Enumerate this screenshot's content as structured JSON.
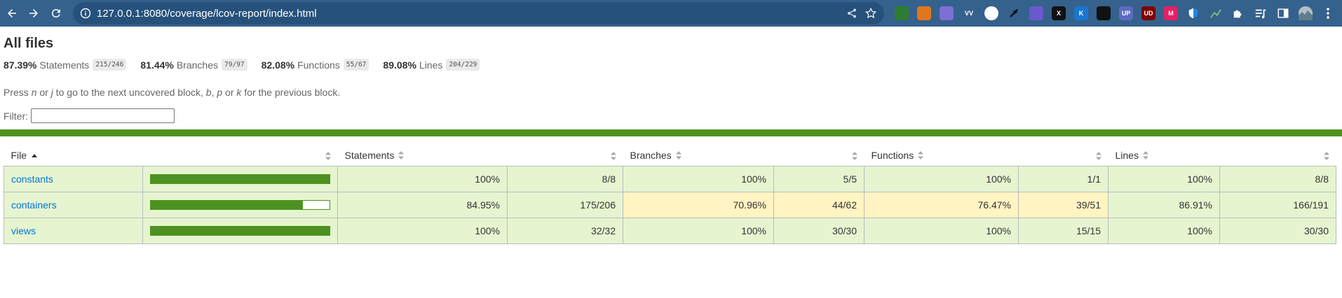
{
  "browser": {
    "url": "127.0.0.1:8080/coverage/lcov-report/index.html"
  },
  "extensions": [
    {
      "name": "ext-turtle-icon",
      "color": "#2e7d32",
      "text": ""
    },
    {
      "name": "ext-fox-icon",
      "color": "#e2761b",
      "text": ""
    },
    {
      "name": "ext-cloud-icon",
      "color": "#7c6fd6",
      "text": ""
    },
    {
      "name": "ext-wv-icon",
      "color": "#35618d",
      "text": "VV"
    },
    {
      "name": "ext-delta-icon",
      "color": "#ffffff",
      "text": ""
    },
    {
      "name": "ext-dropper-icon",
      "color": "#35618d",
      "text": ""
    },
    {
      "name": "ext-swirl-icon",
      "color": "#6a5acd",
      "text": ""
    },
    {
      "name": "ext-x-icon",
      "color": "#111111",
      "text": "X"
    },
    {
      "name": "ext-k-icon",
      "color": "#1976d2",
      "text": "K"
    },
    {
      "name": "ext-dots-icon",
      "color": "#111111",
      "text": ""
    },
    {
      "name": "ext-up-icon",
      "color": "#5c6bc0",
      "text": "UP"
    },
    {
      "name": "ext-ublock-icon",
      "color": "#800000",
      "text": "UD"
    },
    {
      "name": "ext-m-icon",
      "color": "#e91e63",
      "text": "M"
    },
    {
      "name": "ext-shield-icon",
      "color": "#1565c0",
      "text": ""
    },
    {
      "name": "ext-chart-icon",
      "color": "#43a047",
      "text": ""
    },
    {
      "name": "extensions-puzzle-icon",
      "color": "#35618d",
      "text": ""
    },
    {
      "name": "reading-list-icon",
      "color": "#35618d",
      "text": ""
    },
    {
      "name": "side-panel-icon",
      "color": "#35618d",
      "text": ""
    },
    {
      "name": "profile-avatar-icon",
      "color": "#9e9e9e",
      "text": ""
    },
    {
      "name": "menu-kebab-icon",
      "color": "#35618d",
      "text": ""
    }
  ],
  "page": {
    "title": "All files",
    "summary": [
      {
        "pct": "87.39%",
        "label": "Statements",
        "fraction": "215/246"
      },
      {
        "pct": "81.44%",
        "label": "Branches",
        "fraction": "79/97"
      },
      {
        "pct": "82.08%",
        "label": "Functions",
        "fraction": "55/67"
      },
      {
        "pct": "89.08%",
        "label": "Lines",
        "fraction": "204/229"
      }
    ],
    "hint": {
      "part1": "Press ",
      "k1": "n",
      "part2": " or ",
      "k2": "j",
      "part3": " to go to the next uncovered block, ",
      "k3": "b",
      "part4": ", ",
      "k4": "p",
      "part5": " or ",
      "k5": "k",
      "part6": " for the previous block."
    },
    "filter_label": "Filter:",
    "filter_value": ""
  },
  "table": {
    "headers": [
      "File",
      "",
      "Statements",
      "",
      "Branches",
      "",
      "Functions",
      "",
      "Lines",
      ""
    ],
    "rows": [
      {
        "file": "constants",
        "bar_fraction": 1.0,
        "statements_pct": "100%",
        "statements_frac": "8/8",
        "statements_level": "high",
        "branches_pct": "100%",
        "branches_frac": "5/5",
        "branches_level": "high",
        "functions_pct": "100%",
        "functions_frac": "1/1",
        "functions_level": "high",
        "lines_pct": "100%",
        "lines_frac": "8/8",
        "lines_level": "high"
      },
      {
        "file": "containers",
        "bar_fraction": 0.8495,
        "statements_pct": "84.95%",
        "statements_frac": "175/206",
        "statements_level": "high",
        "branches_pct": "70.96%",
        "branches_frac": "44/62",
        "branches_level": "medium",
        "functions_pct": "76.47%",
        "functions_frac": "39/51",
        "functions_level": "medium",
        "lines_pct": "86.91%",
        "lines_frac": "166/191",
        "lines_level": "high"
      },
      {
        "file": "views",
        "bar_fraction": 1.0,
        "statements_pct": "100%",
        "statements_frac": "32/32",
        "statements_level": "high",
        "branches_pct": "100%",
        "branches_frac": "30/30",
        "branches_level": "high",
        "functions_pct": "100%",
        "functions_frac": "15/15",
        "functions_level": "high",
        "lines_pct": "100%",
        "lines_frac": "30/30",
        "lines_level": "high"
      }
    ]
  }
}
